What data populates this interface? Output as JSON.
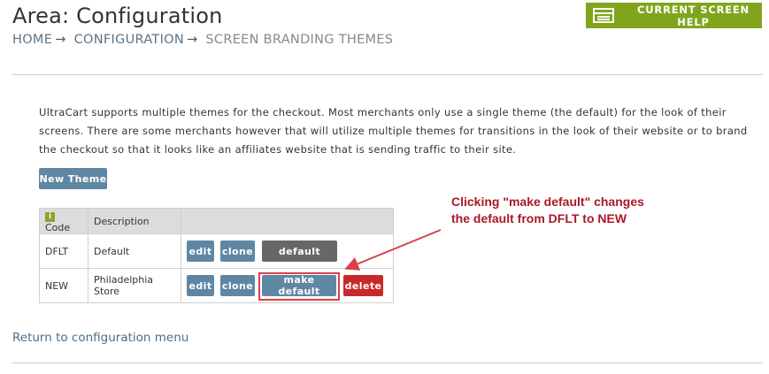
{
  "header": {
    "title": "Area: Configuration",
    "breadcrumb": {
      "home": "HOME",
      "configuration": "CONFIGURATION",
      "current": "SCREEN BRANDING THEMES",
      "separator": "→"
    },
    "help_button": "CURRENT SCREEN HELP"
  },
  "intro_text": "UltraCart supports multiple themes for the checkout. Most merchants only use a single theme (the default) for the look of their screens. There are some merchants however that will utilize multiple themes for transitions in the look of their website or to brand the checkout so that it looks like an affiliates website that is sending traffic to their site.",
  "new_theme_button": "New Theme",
  "table": {
    "columns": {
      "code": "Code",
      "description": "Description",
      "actions": ""
    },
    "rows": [
      {
        "code": "DFLT",
        "description": "Default",
        "edit": "edit",
        "clone": "clone",
        "status": "default"
      },
      {
        "code": "NEW",
        "description": "Philadelphia Store",
        "edit": "edit",
        "clone": "clone",
        "make_default": "make default",
        "delete": "delete"
      }
    ]
  },
  "annotation": {
    "line1": "Clicking \"make default\" changes",
    "line2": "the default from DFLT to NEW"
  },
  "return_link": "Return to configuration menu",
  "colors": {
    "help_green": "#80a51d",
    "button_blue": "#5f87a4",
    "button_gray": "#676767",
    "button_red": "#c8282c",
    "annotation_red": "#a81826"
  }
}
